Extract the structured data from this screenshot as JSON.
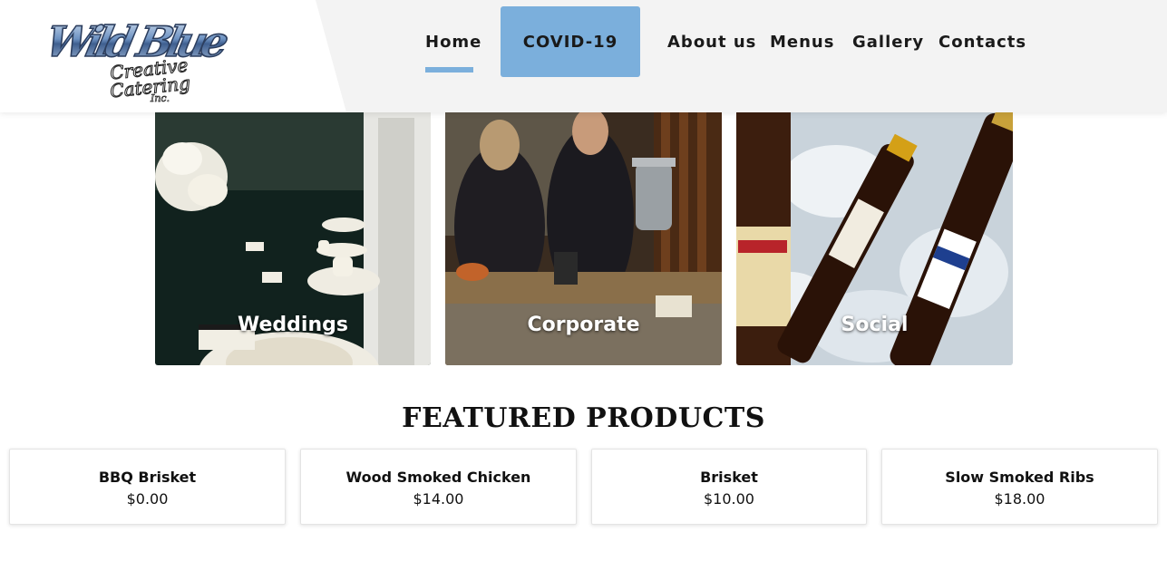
{
  "header": {
    "logo": {
      "line1": "Wild Blue",
      "line2": "Creative",
      "line3": "Catering",
      "line4": "Inc.",
      "color_blue": "#5b82b3",
      "icon": "brand-logo"
    },
    "nav": {
      "home": "Home",
      "covid": "COVID-19",
      "about": "About us",
      "menus": "Menus",
      "gallery": "Gallery",
      "contacts": "Contacts"
    },
    "accent_color": "#7bafdc"
  },
  "categories": [
    {
      "label": "Weddings"
    },
    {
      "label": "Corporate"
    },
    {
      "label": "Social"
    }
  ],
  "featured": {
    "title": "FEATURED PRODUCTS",
    "products": [
      {
        "name": "BBQ Brisket",
        "price": "$0.00"
      },
      {
        "name": "Wood Smoked Chicken",
        "price": "$14.00"
      },
      {
        "name": "Brisket",
        "price": "$10.00"
      },
      {
        "name": "Slow Smoked Ribs",
        "price": "$18.00"
      }
    ]
  }
}
